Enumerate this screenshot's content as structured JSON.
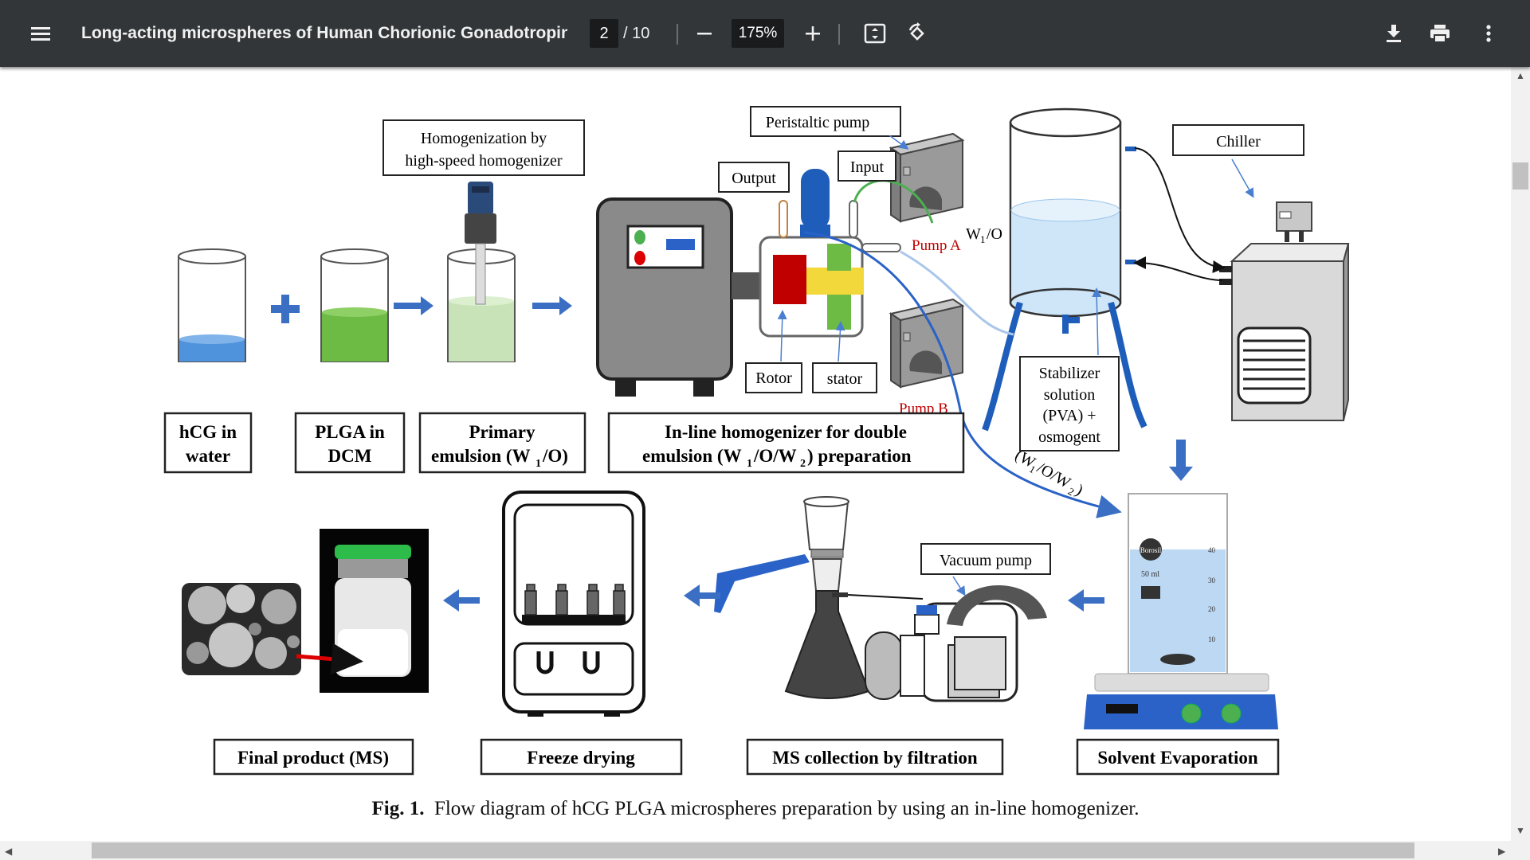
{
  "toolbar": {
    "title": "Long-acting microspheres of Human Chorionic Gonadotropin h...",
    "page_current": "2",
    "page_total": "/ 10",
    "zoom": "175%",
    "icons": [
      "menu-icon",
      "zoom-out-icon",
      "zoom-in-icon",
      "fit-page-icon",
      "rotate-icon",
      "download-icon",
      "print-icon",
      "more-vert-icon"
    ]
  },
  "figure": {
    "top_labels": {
      "homogenization": [
        "Homogenization by",
        "high-speed homogenizer"
      ],
      "peristaltic": "Peristaltic pump",
      "output": "Output",
      "input": "Input",
      "chiller": "Chiller",
      "wio": "W",
      "wio_sub": "1",
      "wio_rest": "/O",
      "pump_a": "Pump A",
      "pump_b": "Pump B",
      "rotor": "Rotor",
      "stator": "stator",
      "stabilizer": [
        "Stabilizer",
        "solution",
        "(PVA) +",
        "osmogent"
      ],
      "flow_label_a": "(W",
      "flow_label_sub1": "1",
      "flow_label_b": "/O/W",
      "flow_label_sub2": "2",
      "flow_label_c": ")",
      "vacuum_pump": "Vacuum pump"
    },
    "step_labels": {
      "hcg": [
        "hCG in",
        "water"
      ],
      "plga": [
        "PLGA in",
        "DCM"
      ],
      "primary_a": "Primary",
      "primary_b": "emulsion (W",
      "primary_sub": "1",
      "primary_c": "/O)",
      "inline_a": "In-line homogenizer for double",
      "inline_b": "emulsion (W",
      "inline_sub1": "1",
      "inline_c": "/O/W",
      "inline_sub2": "2",
      "inline_d": ") preparation",
      "final": "Final product (MS)",
      "freeze": "Freeze drying",
      "filtration": "MS collection by filtration",
      "evaporation": "Solvent Evaporation"
    },
    "beaker_marks": [
      "40",
      "30",
      "20",
      "10"
    ],
    "beaker_brand": "Borosil",
    "beaker_volume": "50 ml",
    "caption_bold": "Fig. 1.",
    "caption_text": "Flow diagram of hCG PLGA microspheres preparation by using an in-line homogenizer.",
    "colors": {
      "blue_arrow": "#3a6fc4",
      "green_liquid": "#6dba45",
      "light_green": "#c9e3b8",
      "water_blue": "#4f93dc",
      "pump_red": "#c00000"
    }
  }
}
